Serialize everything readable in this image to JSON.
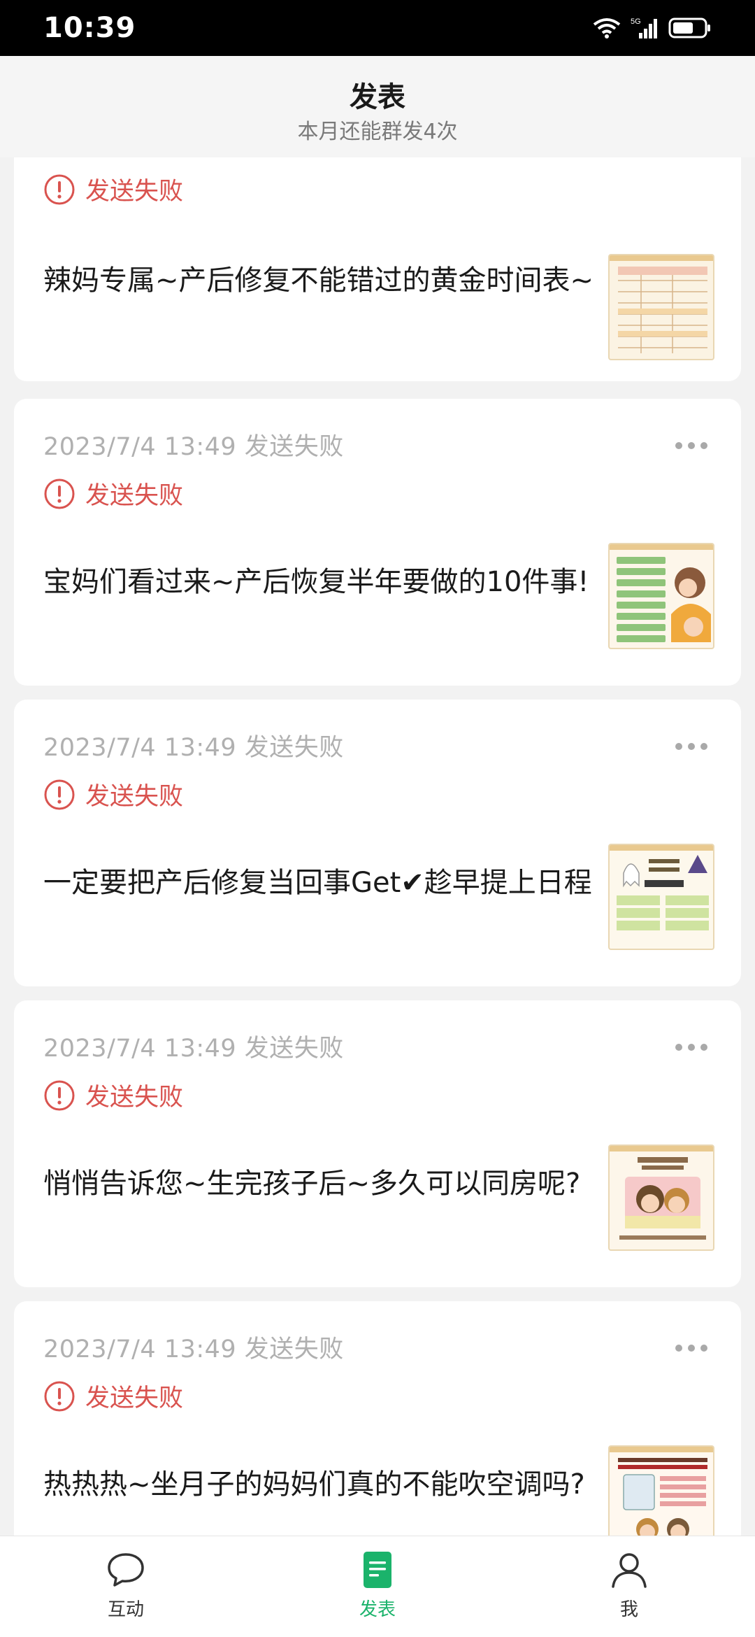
{
  "status_bar": {
    "time": "10:39",
    "network": "5G"
  },
  "header": {
    "title": "发表",
    "subtitle": "本月还能群发4次"
  },
  "posts": [
    {
      "time": "",
      "status": "发送失败",
      "title": "辣妈专属~产后修复不能错过的黄金时间表~",
      "thumb_icon": "schedule-table-thumbnail"
    },
    {
      "time": "2023/7/4 13:49 发送失败",
      "status": "发送失败",
      "title": "宝妈们看过来~产后恢复半年要做的10件事!",
      "thumb_icon": "checklist-mother-thumbnail"
    },
    {
      "time": "2023/7/4 13:49 发送失败",
      "status": "发送失败",
      "title": "一定要把产后修复当回事Get✔趁早提上日程",
      "thumb_icon": "ghost-checklist-thumbnail"
    },
    {
      "time": "2023/7/4 13:49 发送失败",
      "status": "发送失败",
      "title": "悄悄告诉您~生完孩子后~多久可以同房呢?",
      "thumb_icon": "couple-illustration-thumbnail"
    },
    {
      "time": "2023/7/4 13:49 发送失败",
      "status": "发送失败",
      "title": "热热热~坐月子的妈妈们真的不能吹空调吗?",
      "thumb_icon": "air-conditioner-thumbnail"
    }
  ],
  "tabs": [
    {
      "label": "互动",
      "icon": "chat-bubble-icon",
      "active": false
    },
    {
      "label": "发表",
      "icon": "document-icon",
      "active": true
    },
    {
      "label": "我",
      "icon": "person-icon",
      "active": false
    }
  ],
  "colors": {
    "accent": "#1bb36b",
    "error": "#d9534f",
    "muted": "#b0b0b0",
    "background": "#f2f2f2"
  }
}
